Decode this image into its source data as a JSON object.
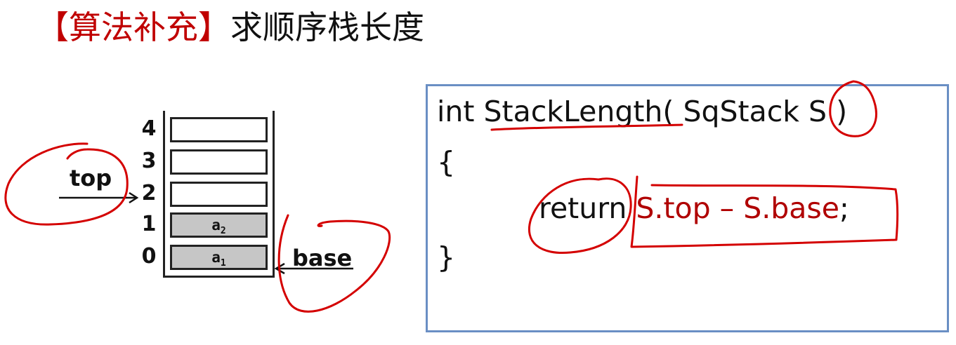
{
  "slide": {
    "title_tag": "【算法补充】",
    "title_main": "求顺序栈长度"
  },
  "stack": {
    "indices": [
      "4",
      "3",
      "2",
      "1",
      "0"
    ],
    "elements": {
      "a2": "a",
      "a2_sub": "2",
      "a1": "a",
      "a1_sub": "1"
    },
    "top_label": "top",
    "base_label": "base"
  },
  "code": {
    "line1": "int StackLength( SqStack S )",
    "line2": "{",
    "line3_kw": "return ",
    "line3_expr": "S.top – S.base",
    "line3_end": ";",
    "line4": "}"
  },
  "colors": {
    "accent_red": "#c00000",
    "box_border": "#6a8fc4",
    "ink_red": "#d40000",
    "filled_cell": "#c6c6c6"
  }
}
